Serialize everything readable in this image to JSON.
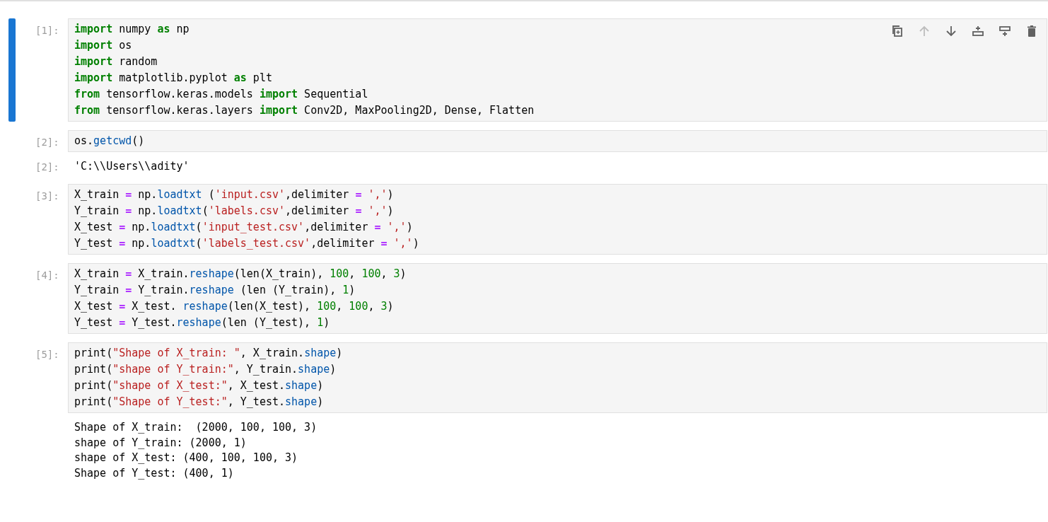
{
  "cells": [
    {
      "prompt": "[1]:",
      "selected": true,
      "toolbar": [
        {
          "kind": "duplicate",
          "disabled": false
        },
        {
          "kind": "move-up",
          "disabled": true
        },
        {
          "kind": "move-down",
          "disabled": false
        },
        {
          "kind": "insert-above",
          "disabled": false
        },
        {
          "kind": "insert-below",
          "disabled": false
        },
        {
          "kind": "delete",
          "disabled": false
        }
      ],
      "lines": [
        [
          {
            "kind": "kw",
            "text": "import"
          },
          {
            "kind": "plain",
            "text": " numpy "
          },
          {
            "kind": "kw",
            "text": "as"
          },
          {
            "kind": "plain",
            "text": " np"
          }
        ],
        [
          {
            "kind": "kw",
            "text": "import"
          },
          {
            "kind": "plain",
            "text": " os"
          }
        ],
        [
          {
            "kind": "kw",
            "text": "import"
          },
          {
            "kind": "plain",
            "text": " random"
          }
        ],
        [
          {
            "kind": "kw",
            "text": "import"
          },
          {
            "kind": "plain",
            "text": " matplotlib.pyplot "
          },
          {
            "kind": "kw",
            "text": "as"
          },
          {
            "kind": "plain",
            "text": " plt"
          }
        ],
        [
          {
            "kind": "kw",
            "text": "from"
          },
          {
            "kind": "plain",
            "text": " tensorflow.keras.models "
          },
          {
            "kind": "kw",
            "text": "import"
          },
          {
            "kind": "plain",
            "text": " Sequential"
          }
        ],
        [
          {
            "kind": "kw",
            "text": "from"
          },
          {
            "kind": "plain",
            "text": " tensorflow.keras.layers "
          },
          {
            "kind": "kw",
            "text": "import"
          },
          {
            "kind": "plain",
            "text": " Conv2D, MaxPooling2D, Dense, Flatten"
          }
        ]
      ]
    },
    {
      "prompt": "[2]:",
      "selected": false,
      "lines": [
        [
          {
            "kind": "plain",
            "text": "os."
          },
          {
            "kind": "attr",
            "text": "getcwd"
          },
          {
            "kind": "plain",
            "text": "()"
          }
        ]
      ],
      "output": {
        "prompt": "[2]:",
        "lines": [
          "'C:\\\\Users\\\\adity'"
        ]
      }
    },
    {
      "prompt": "[3]:",
      "selected": false,
      "lines": [
        [
          {
            "kind": "plain",
            "text": "X_train "
          },
          {
            "kind": "op",
            "text": "="
          },
          {
            "kind": "plain",
            "text": " np."
          },
          {
            "kind": "attr",
            "text": "loadtxt"
          },
          {
            "kind": "plain",
            "text": " ("
          },
          {
            "kind": "str",
            "text": "'input.csv'"
          },
          {
            "kind": "plain",
            "text": ",delimiter "
          },
          {
            "kind": "op",
            "text": "="
          },
          {
            "kind": "str",
            "text": " ','"
          },
          {
            "kind": "plain",
            "text": ")"
          }
        ],
        [
          {
            "kind": "plain",
            "text": "Y_train "
          },
          {
            "kind": "op",
            "text": "="
          },
          {
            "kind": "plain",
            "text": " np."
          },
          {
            "kind": "attr",
            "text": "loadtxt"
          },
          {
            "kind": "plain",
            "text": "("
          },
          {
            "kind": "str",
            "text": "'labels.csv'"
          },
          {
            "kind": "plain",
            "text": ",delimiter "
          },
          {
            "kind": "op",
            "text": "="
          },
          {
            "kind": "str",
            "text": " ','"
          },
          {
            "kind": "plain",
            "text": ")"
          }
        ],
        [
          {
            "kind": "plain",
            "text": "X_test "
          },
          {
            "kind": "op",
            "text": "="
          },
          {
            "kind": "plain",
            "text": " np."
          },
          {
            "kind": "attr",
            "text": "loadtxt"
          },
          {
            "kind": "plain",
            "text": "("
          },
          {
            "kind": "str",
            "text": "'input_test.csv'"
          },
          {
            "kind": "plain",
            "text": ",delimiter "
          },
          {
            "kind": "op",
            "text": "="
          },
          {
            "kind": "str",
            "text": " ','"
          },
          {
            "kind": "plain",
            "text": ")"
          }
        ],
        [
          {
            "kind": "plain",
            "text": "Y_test "
          },
          {
            "kind": "op",
            "text": "="
          },
          {
            "kind": "plain",
            "text": " np."
          },
          {
            "kind": "attr",
            "text": "loadtxt"
          },
          {
            "kind": "plain",
            "text": "("
          },
          {
            "kind": "str",
            "text": "'labels_test.csv'"
          },
          {
            "kind": "plain",
            "text": ",delimiter "
          },
          {
            "kind": "op",
            "text": "="
          },
          {
            "kind": "str",
            "text": " ','"
          },
          {
            "kind": "plain",
            "text": ")"
          }
        ]
      ]
    },
    {
      "prompt": "[4]:",
      "selected": false,
      "lines": [
        [
          {
            "kind": "plain",
            "text": "X_train "
          },
          {
            "kind": "op",
            "text": "="
          },
          {
            "kind": "plain",
            "text": " X_train."
          },
          {
            "kind": "attr",
            "text": "reshape"
          },
          {
            "kind": "plain",
            "text": "(len(X_train), "
          },
          {
            "kind": "num",
            "text": "100"
          },
          {
            "kind": "plain",
            "text": ", "
          },
          {
            "kind": "num",
            "text": "100"
          },
          {
            "kind": "plain",
            "text": ", "
          },
          {
            "kind": "num",
            "text": "3"
          },
          {
            "kind": "plain",
            "text": ")"
          }
        ],
        [
          {
            "kind": "plain",
            "text": "Y_train "
          },
          {
            "kind": "op",
            "text": "="
          },
          {
            "kind": "plain",
            "text": " Y_train."
          },
          {
            "kind": "attr",
            "text": "reshape"
          },
          {
            "kind": "plain",
            "text": " (len (Y_train), "
          },
          {
            "kind": "num",
            "text": "1"
          },
          {
            "kind": "plain",
            "text": ")"
          }
        ],
        [
          {
            "kind": "plain",
            "text": "X_test "
          },
          {
            "kind": "op",
            "text": "="
          },
          {
            "kind": "plain",
            "text": " X_test. "
          },
          {
            "kind": "attr",
            "text": "reshape"
          },
          {
            "kind": "plain",
            "text": "(len(X_test), "
          },
          {
            "kind": "num",
            "text": "100"
          },
          {
            "kind": "plain",
            "text": ", "
          },
          {
            "kind": "num",
            "text": "100"
          },
          {
            "kind": "plain",
            "text": ", "
          },
          {
            "kind": "num",
            "text": "3"
          },
          {
            "kind": "plain",
            "text": ")"
          }
        ],
        [
          {
            "kind": "plain",
            "text": "Y_test "
          },
          {
            "kind": "op",
            "text": "="
          },
          {
            "kind": "plain",
            "text": " Y_test."
          },
          {
            "kind": "attr",
            "text": "reshape"
          },
          {
            "kind": "plain",
            "text": "(len (Y_test), "
          },
          {
            "kind": "num",
            "text": "1"
          },
          {
            "kind": "plain",
            "text": ")"
          }
        ]
      ]
    },
    {
      "prompt": "[5]:",
      "selected": false,
      "lines": [
        [
          {
            "kind": "plain",
            "text": "print("
          },
          {
            "kind": "str",
            "text": "\"Shape of X_train: \""
          },
          {
            "kind": "plain",
            "text": ", X_train."
          },
          {
            "kind": "attr",
            "text": "shape"
          },
          {
            "kind": "plain",
            "text": ")"
          }
        ],
        [
          {
            "kind": "plain",
            "text": "print("
          },
          {
            "kind": "str",
            "text": "\"shape of Y_train:\""
          },
          {
            "kind": "plain",
            "text": ", Y_train."
          },
          {
            "kind": "attr",
            "text": "shape"
          },
          {
            "kind": "plain",
            "text": ")"
          }
        ],
        [
          {
            "kind": "plain",
            "text": "print("
          },
          {
            "kind": "str",
            "text": "\"shape of X_test:\""
          },
          {
            "kind": "plain",
            "text": ", X_test."
          },
          {
            "kind": "attr",
            "text": "shape"
          },
          {
            "kind": "plain",
            "text": ")"
          }
        ],
        [
          {
            "kind": "plain",
            "text": "print("
          },
          {
            "kind": "str",
            "text": "\"Shape of Y_test:\""
          },
          {
            "kind": "plain",
            "text": ", Y_test."
          },
          {
            "kind": "attr",
            "text": "shape"
          },
          {
            "kind": "plain",
            "text": ")"
          }
        ]
      ],
      "output": {
        "lines": [
          "Shape of X_train:  (2000, 100, 100, 3)",
          "shape of Y_train: (2000, 1)",
          "shape of X_test: (400, 100, 100, 3)",
          "Shape of Y_test: (400, 1)"
        ]
      }
    }
  ]
}
